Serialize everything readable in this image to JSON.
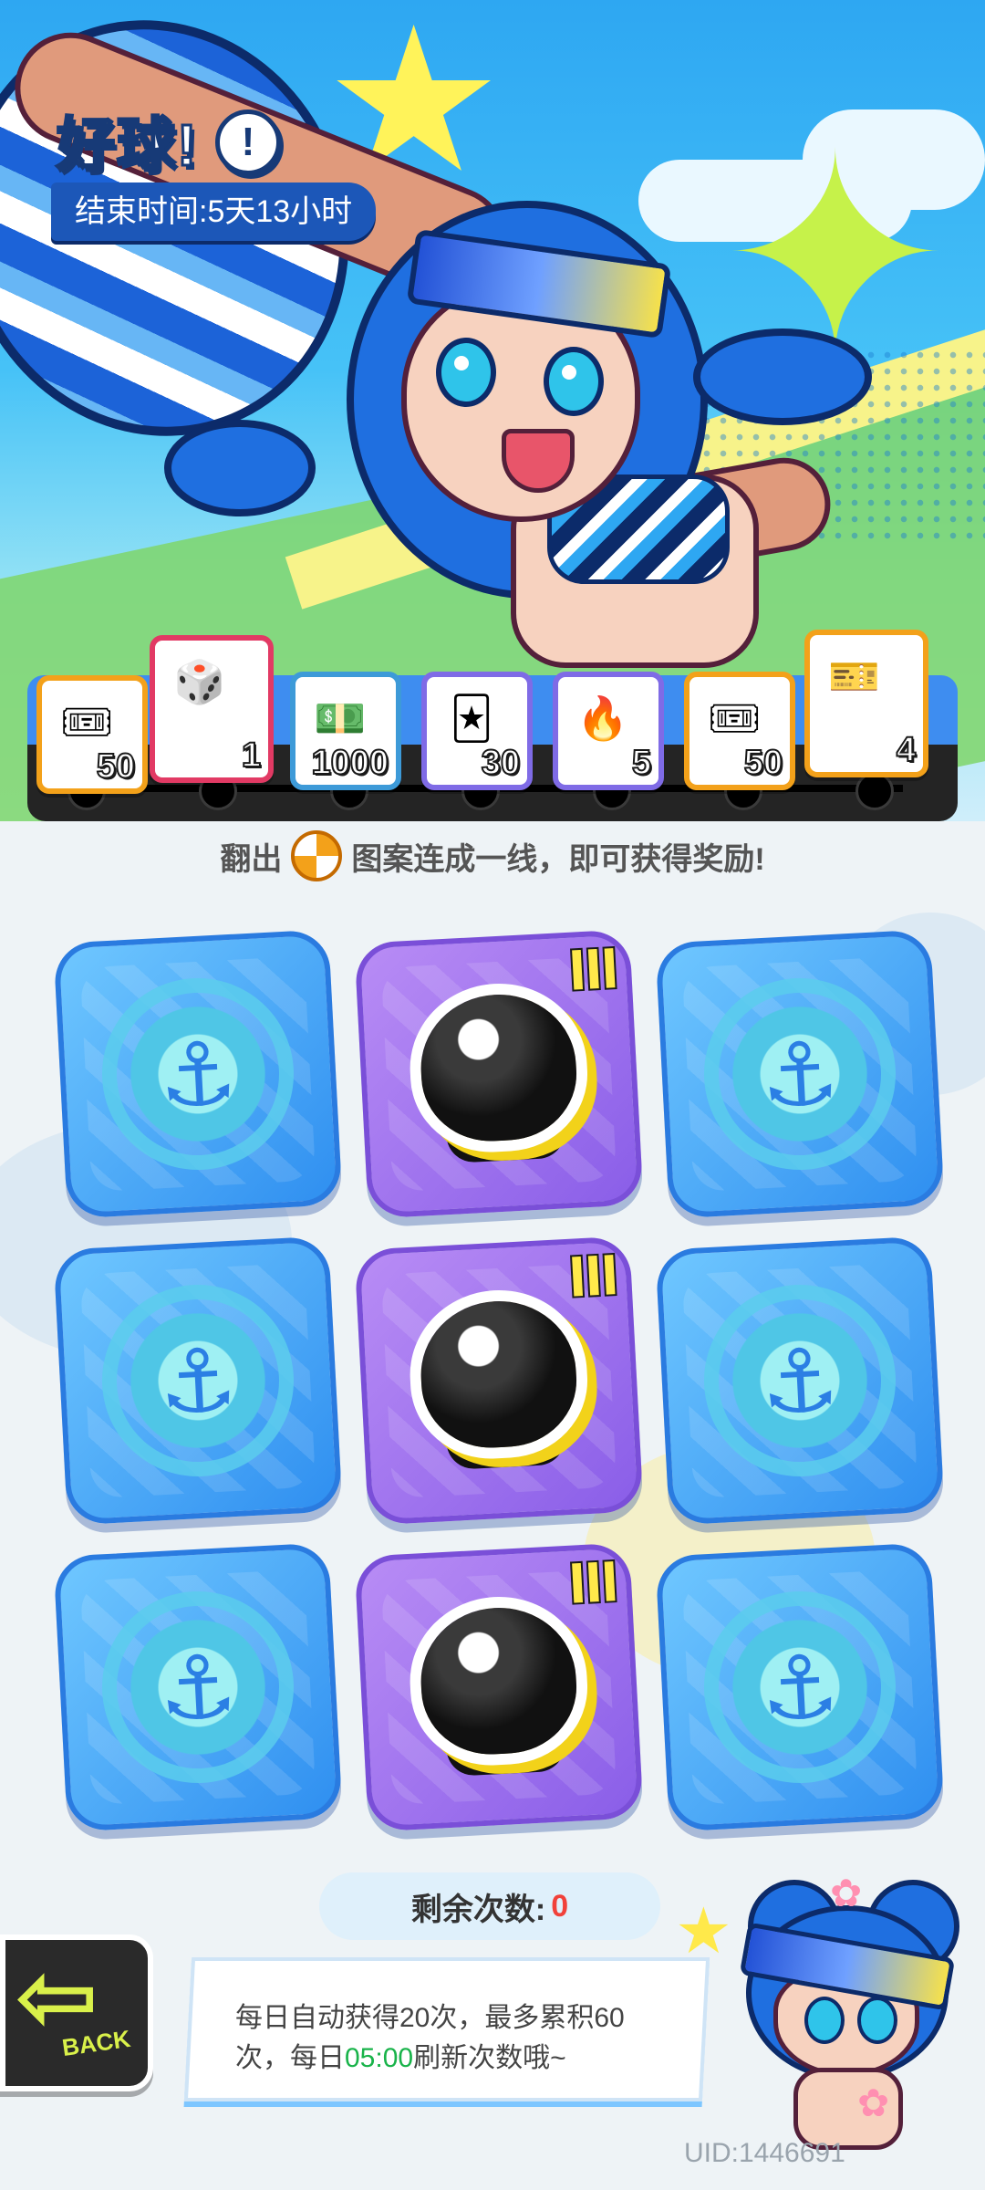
{
  "event": {
    "title_first_char": "好",
    "title_rest": "球!",
    "info_icon": "!",
    "end_time": "结束时间:5天13小时"
  },
  "rewards": [
    {
      "icon": "ticket-icon",
      "glyph": "🎟",
      "qty": "50",
      "color": "orange"
    },
    {
      "icon": "go-dice-icon",
      "glyph": "🎲",
      "qty": "1",
      "color": "red"
    },
    {
      "icon": "cash-icon",
      "glyph": "💵",
      "qty": "1000",
      "color": "green"
    },
    {
      "icon": "cards-icon",
      "glyph": "🃏",
      "qty": "30",
      "color": "purple"
    },
    {
      "icon": "flame-icon",
      "glyph": "🔥",
      "qty": "5",
      "color": "purple"
    },
    {
      "icon": "ticket-icon",
      "glyph": "🎟",
      "qty": "50",
      "color": "orange"
    },
    {
      "icon": "star-ticket-icon",
      "glyph": "🎫",
      "qty": "4",
      "color": "orange"
    }
  ],
  "instruction": {
    "before": "翻出",
    "icon": "volleyball-icon",
    "after": "图案连成一线，即可获得奖励!"
  },
  "grid": [
    [
      "anchor",
      "ink",
      "anchor"
    ],
    [
      "anchor",
      "ink",
      "anchor"
    ],
    [
      "anchor",
      "ink",
      "anchor"
    ]
  ],
  "remaining": {
    "label": "剩余次数:",
    "value": "0"
  },
  "back": {
    "label": "BACK"
  },
  "notice": {
    "line1": "每日自动获得20次，最多累积60",
    "line2_pre": "次，每日",
    "time": "05:00",
    "line2_post": "刷新次数哦~"
  },
  "uid": "UID:1446691",
  "colors": {
    "accent": "#2f8ff0",
    "purple": "#8a5ee8",
    "green_time": "#19b34a",
    "count_red": "#f1413a"
  }
}
